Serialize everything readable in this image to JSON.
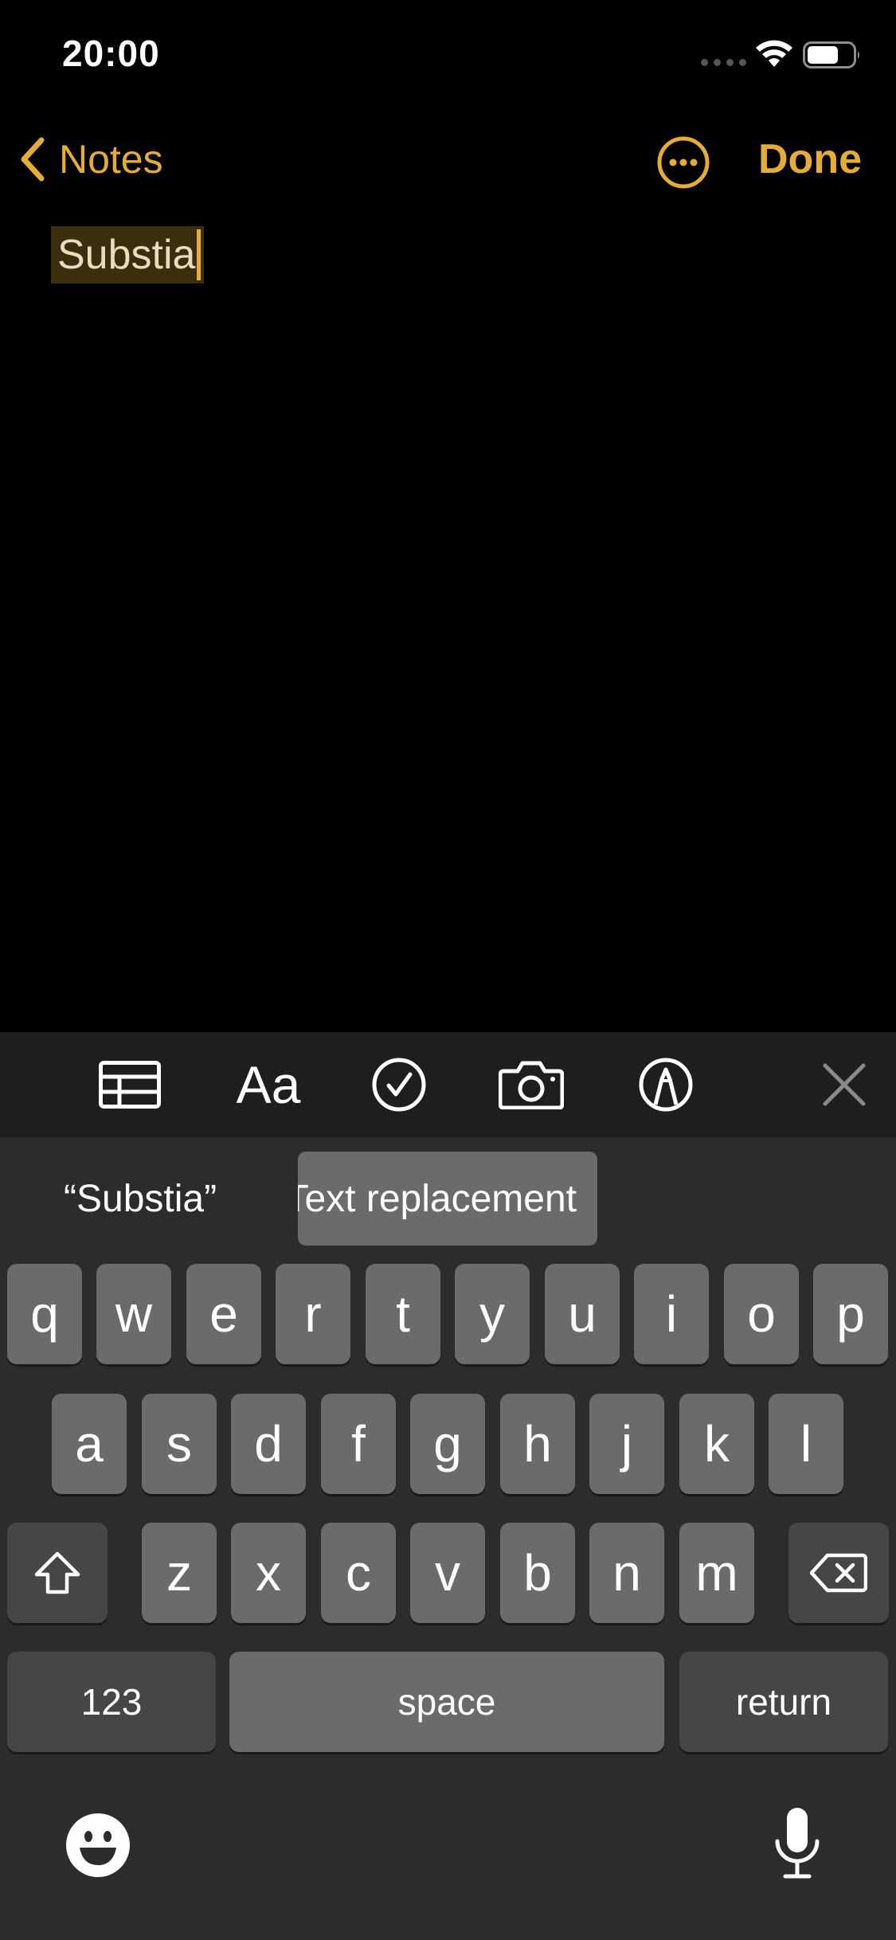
{
  "status": {
    "time": "20:00"
  },
  "nav": {
    "back_label": "Notes",
    "done_label": "Done"
  },
  "note": {
    "text": "Substia"
  },
  "toolbar": {
    "format_label": "Aa"
  },
  "suggestions": {
    "left": "“Substia”",
    "right": "Text replacement"
  },
  "keyboard": {
    "row1": [
      "q",
      "w",
      "e",
      "r",
      "t",
      "y",
      "u",
      "i",
      "o",
      "p"
    ],
    "row2": [
      "a",
      "s",
      "d",
      "f",
      "g",
      "h",
      "j",
      "k",
      "l"
    ],
    "row3": [
      "z",
      "x",
      "c",
      "v",
      "b",
      "n",
      "m"
    ],
    "numbers_label": "123",
    "space_label": "space",
    "return_label": "return"
  },
  "colors": {
    "accent": "#e5ad34",
    "background": "#000000",
    "key": "#6b6b6b",
    "key_dark": "#464646"
  },
  "icons": {
    "back": "chevron-left-icon",
    "more": "ellipsis-circle-icon",
    "table": "table-icon",
    "checklist": "checkmark-circle-icon",
    "camera": "camera-icon",
    "markup": "pen-tip-circle-icon",
    "close": "close-icon",
    "shift": "shift-icon",
    "delete": "delete-backward-icon",
    "emoji": "emoji-icon",
    "mic": "microphone-icon"
  }
}
